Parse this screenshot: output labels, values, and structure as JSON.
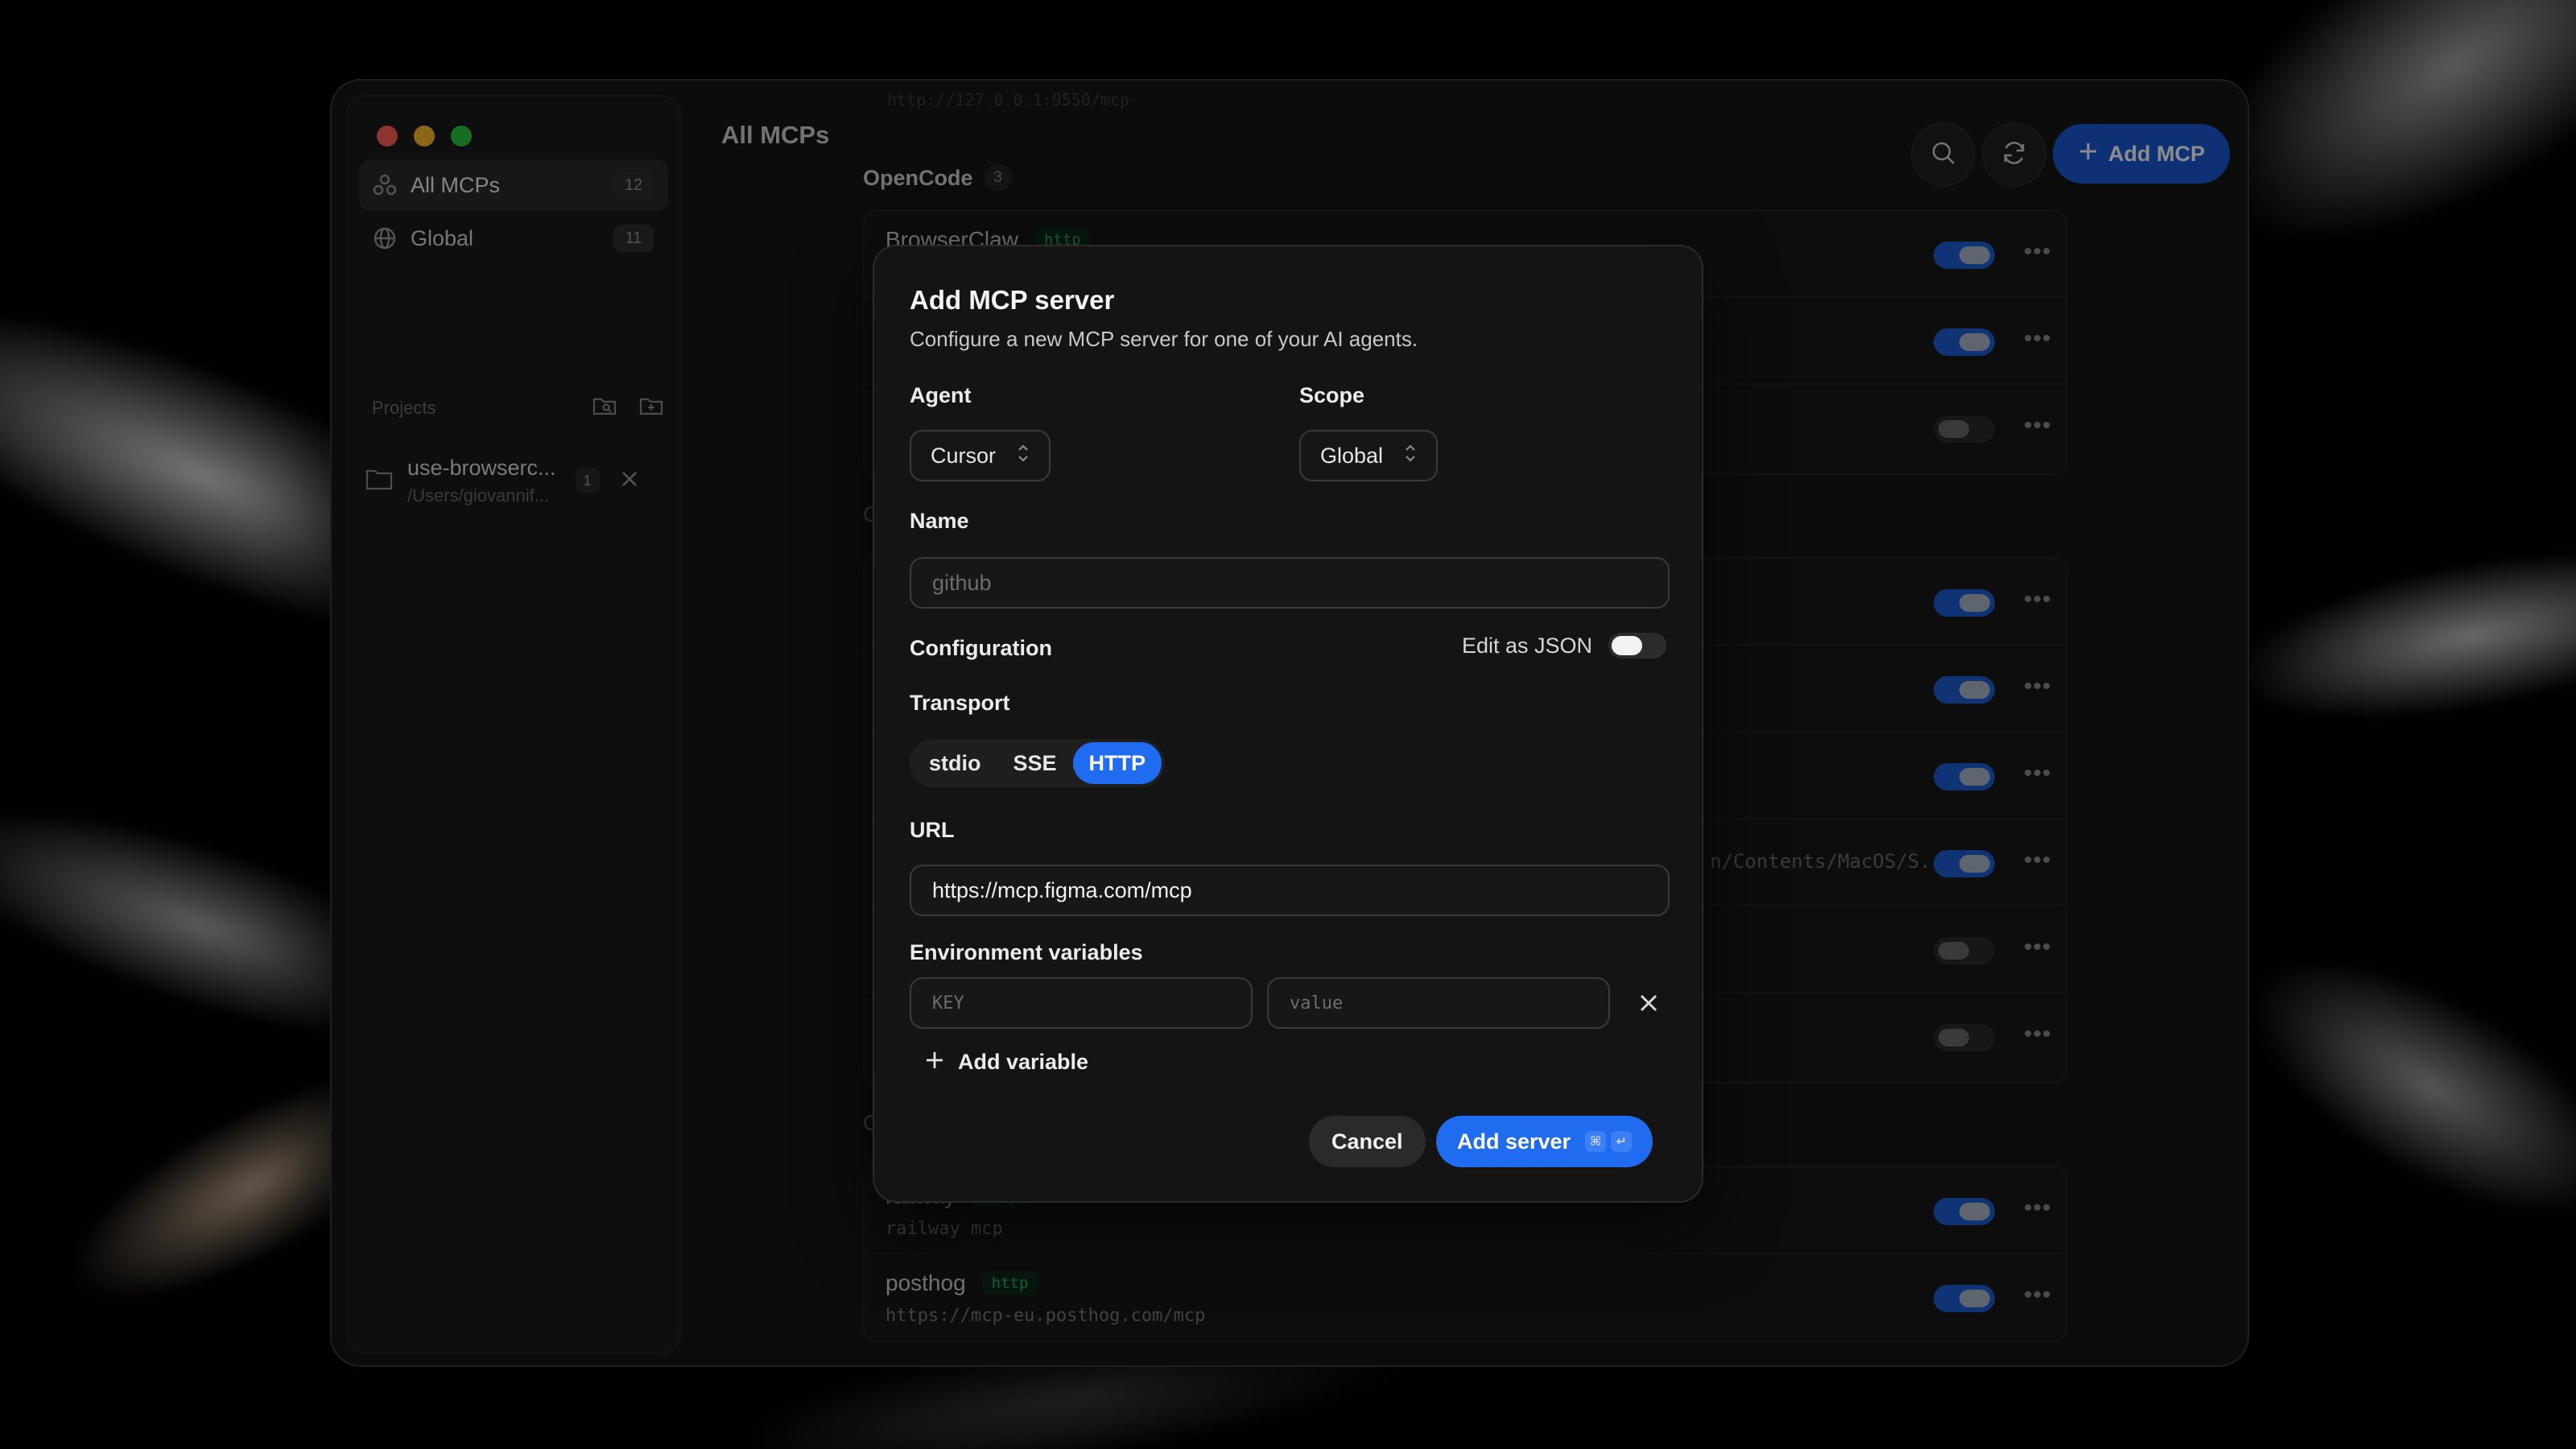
{
  "app": {
    "page_title": "All MCPs",
    "header_url_ghost": "http://127.0.0.1:9550/mcp"
  },
  "sidebar": {
    "items": [
      {
        "label": "All MCPs",
        "count": "12",
        "icon": "agents-icon"
      },
      {
        "label": "Global",
        "count": "11",
        "icon": "globe-icon"
      }
    ],
    "projects_label": "Projects",
    "project": {
      "name": "use-browserc...",
      "path": "/Users/giovannif...",
      "count": "1"
    }
  },
  "header": {
    "add_mcp_label": "Add MCP",
    "icons": [
      "search-icon",
      "refresh-icon",
      "plus-icon"
    ]
  },
  "sections": {
    "opencode": {
      "title": "OpenCode",
      "count": "3"
    },
    "ghost_letter": "C",
    "rows": {
      "browserclaw": {
        "name": "BrowserClaw",
        "badge": "http"
      },
      "contents_path": "n/Contents/MacOS/S...",
      "railway": {
        "name": "railway",
        "badge": "http",
        "sub": "railway mcp"
      },
      "posthog": {
        "name": "posthog",
        "badge": "http",
        "sub": "https://mcp-eu.posthog.com/mcp"
      }
    }
  },
  "modal": {
    "title": "Add MCP server",
    "description": "Configure a new MCP server for one of your AI agents.",
    "agent_label": "Agent",
    "agent_value": "Cursor",
    "scope_label": "Scope",
    "scope_value": "Global",
    "name_label": "Name",
    "name_placeholder": "github",
    "configuration_label": "Configuration",
    "edit_json_label": "Edit as JSON",
    "edit_json_enabled": false,
    "transport_label": "Transport",
    "transport_options": [
      "stdio",
      "SSE",
      "HTTP"
    ],
    "transport_selected": "HTTP",
    "url_label": "URL",
    "url_value": "https://mcp.figma.com/mcp",
    "env_label": "Environment variables",
    "env_key_placeholder": "KEY",
    "env_value_placeholder": "value",
    "add_variable_label": "Add variable",
    "cancel_label": "Cancel",
    "submit_label": "Add server",
    "submit_shortcut": [
      "⌘",
      "↵"
    ]
  },
  "colors": {
    "accent": "#1f6cf0",
    "http_badge": "#27b36a",
    "background": "#161616"
  }
}
